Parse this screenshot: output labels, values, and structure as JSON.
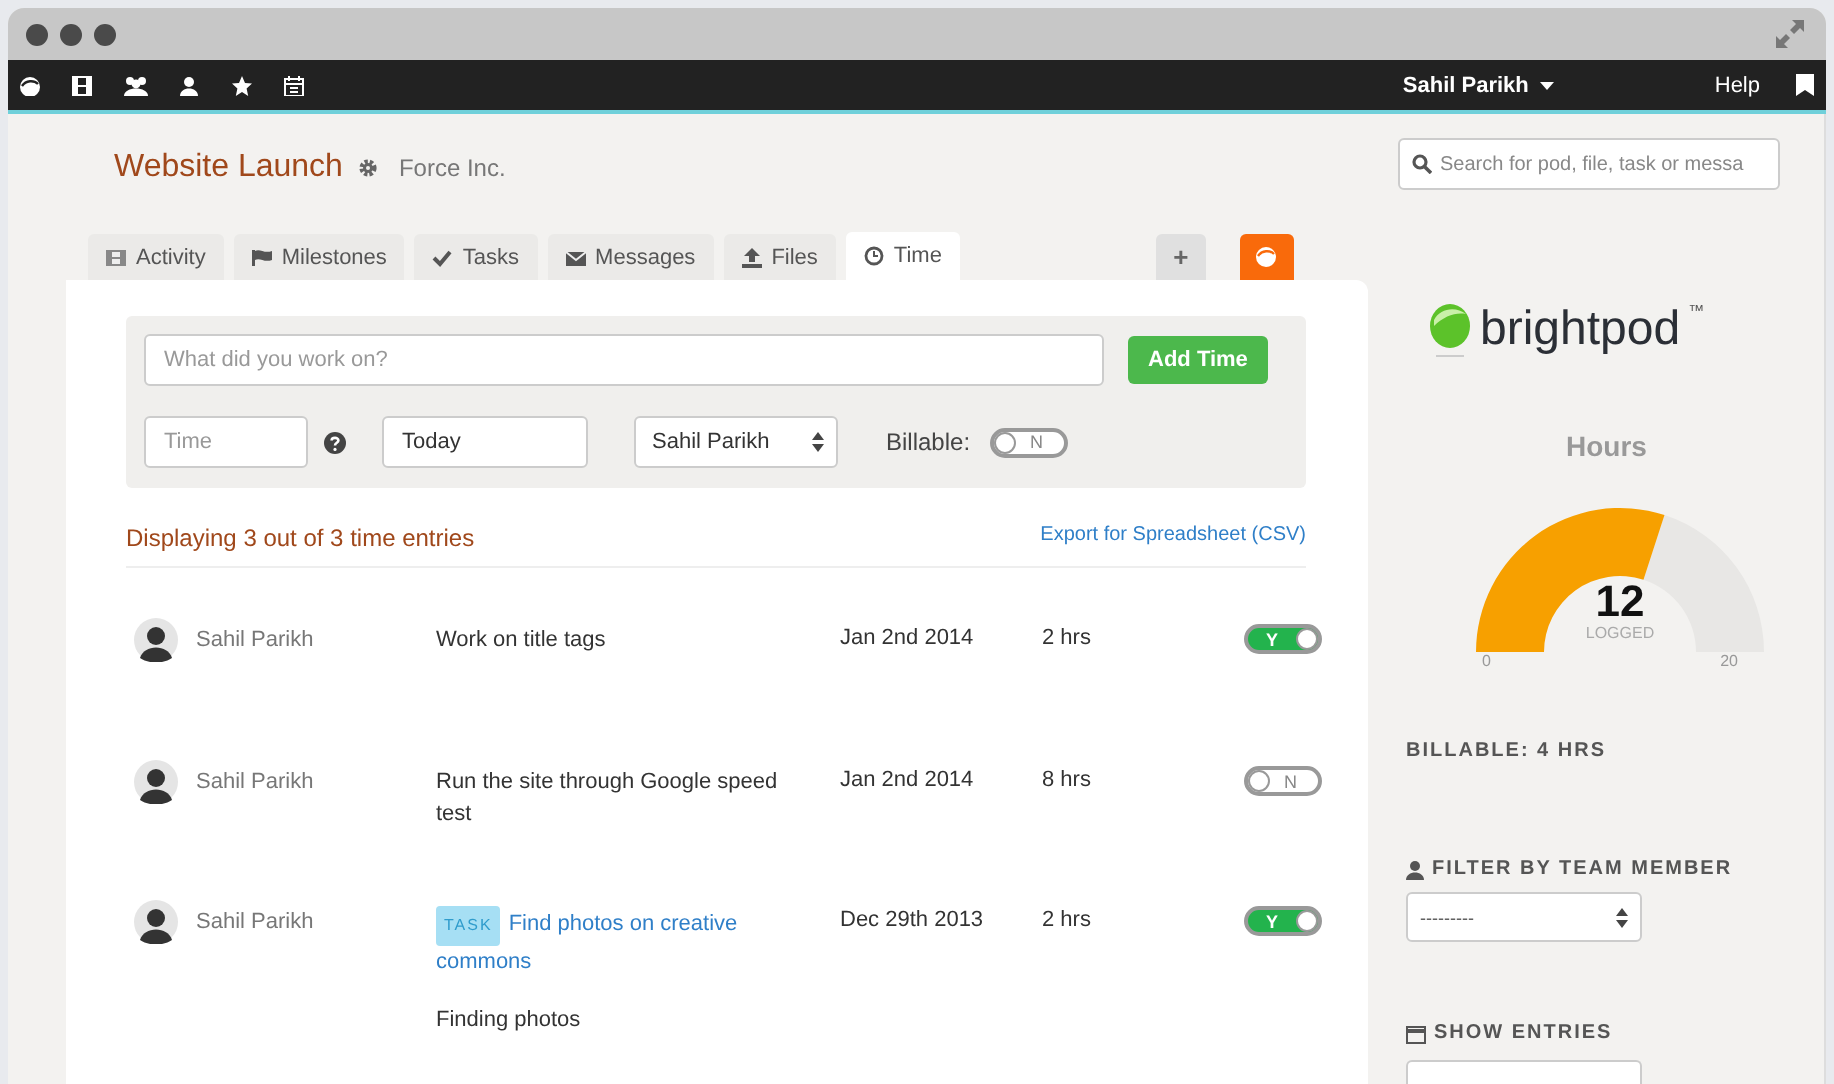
{
  "navbar": {
    "user": "Sahil Parikh",
    "help": "Help"
  },
  "project": {
    "title": "Website Launch",
    "company": "Force Inc."
  },
  "search": {
    "placeholder": "Search for pod, file, task or messa"
  },
  "tabs": [
    {
      "label": "Activity",
      "selected": false
    },
    {
      "label": "Milestones",
      "selected": false
    },
    {
      "label": "Tasks",
      "selected": false
    },
    {
      "label": "Messages",
      "selected": false
    },
    {
      "label": "Files",
      "selected": false
    },
    {
      "label": "Time",
      "selected": true
    }
  ],
  "add_tab": "+",
  "form": {
    "work_placeholder": "What did you work on?",
    "add_button": "Add Time",
    "time_placeholder": "Time",
    "date_value": "Today",
    "member_value": "Sahil Parikh",
    "billable_label": "Billable:",
    "billable": {
      "on": false,
      "text": "N"
    }
  },
  "summary": "Displaying 3 out of 3 time entries",
  "export_link": "Export for Spreadsheet (CSV)",
  "entries": [
    {
      "kind": "plain",
      "member": "Sahil Parikh",
      "description": "Work on title tags",
      "date": "Jan 2nd 2014",
      "hours": "2 hrs",
      "billable": {
        "on": true,
        "text": "Y"
      }
    },
    {
      "kind": "plain",
      "member": "Sahil Parikh",
      "description": "Run the site through Google speed test",
      "date": "Jan 2nd 2014",
      "hours": "8 hrs",
      "billable": {
        "on": false,
        "text": "N"
      }
    },
    {
      "kind": "task",
      "member": "Sahil Parikh",
      "tag": "TASK",
      "description": "Find photos on creative commons",
      "note": "Finding photos",
      "date": "Dec 29th 2013",
      "hours": "2 hrs",
      "billable": {
        "on": true,
        "text": "Y"
      }
    }
  ],
  "sidebar": {
    "logo": "brightpod",
    "trademark": "™",
    "hours": {
      "title": "Hours",
      "value": "12",
      "caption": "LOGGED",
      "min": "0",
      "max": "20",
      "level": 0.6
    },
    "billable_total": "BILLABLE: 4 HRS",
    "filter_label": "FILTER BY TEAM MEMBER",
    "filter_value": "---------",
    "show_label": "SHOW ENTRIES"
  }
}
